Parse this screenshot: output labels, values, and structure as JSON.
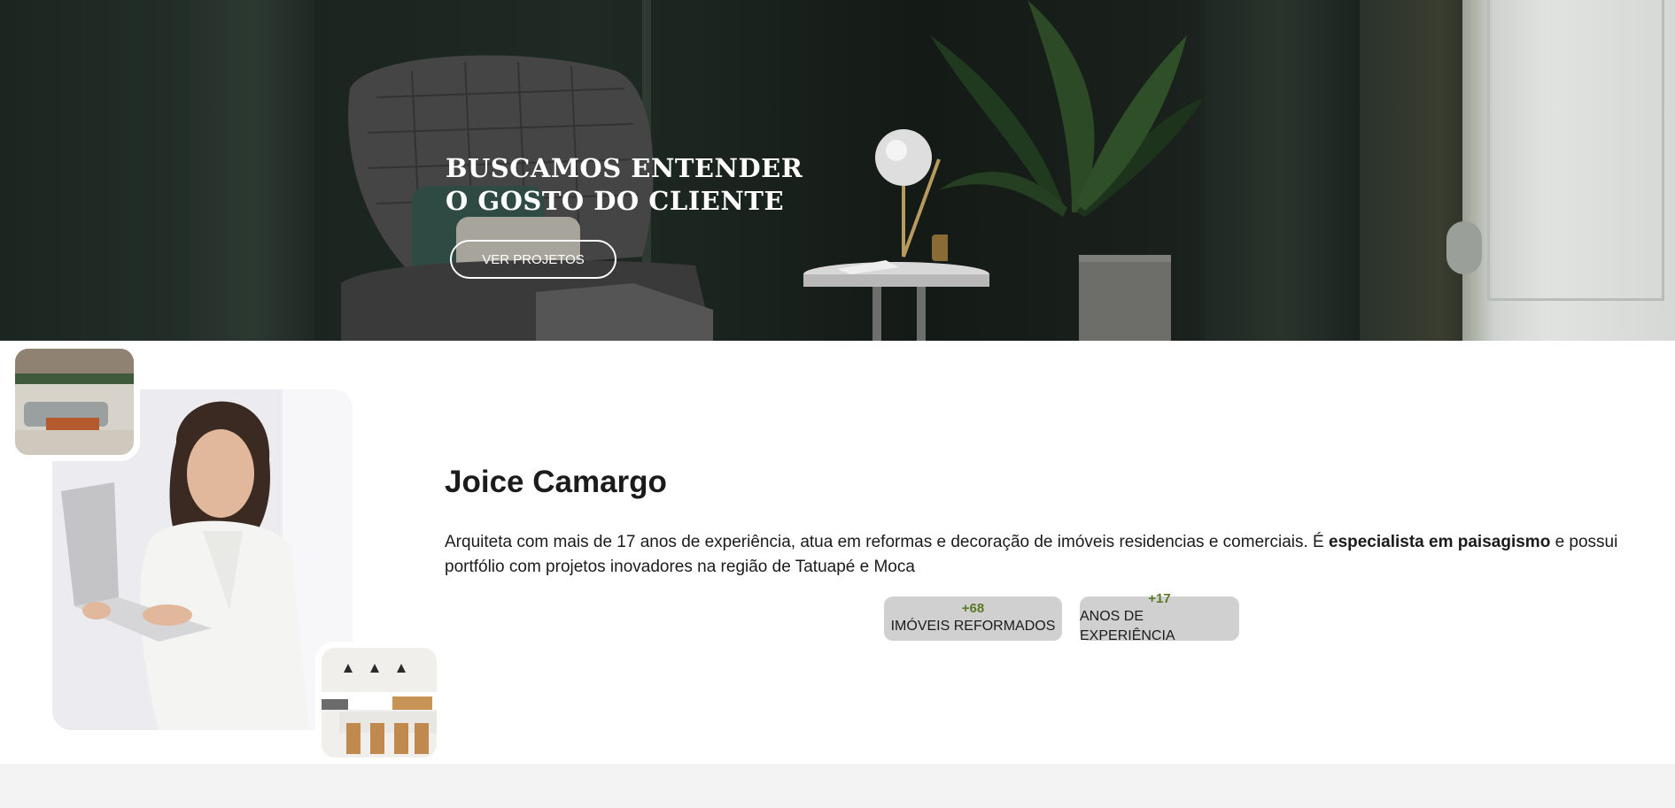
{
  "hero": {
    "title_line1": "BUSCAMOS ENTENDER",
    "title_line2": "O GOSTO DO CLIENTE",
    "cta_label": "VER PROJETOS"
  },
  "about": {
    "name": "Joice Camargo",
    "bio_prefix": "Arquiteta com mais de 17 anos de experiência, atua em reformas e decoração de imóveis residencias e comerciais. É ",
    "bio_bold": "especialista em paisagismo",
    "bio_suffix": " e possui portfólio com projetos inovadores na região de Tatuapé e Moca",
    "stats": [
      {
        "value": "+68",
        "label": "IMÓVEIS REFORMADOS"
      },
      {
        "value": "+17",
        "label": "ANOS DE EXPERIÊNCIA"
      }
    ]
  },
  "colors": {
    "accent_green": "#5a7a25",
    "stat_bg": "#d0d0d0",
    "hero_bg": "#1b241f"
  },
  "icons": [
    "hero-background-image",
    "portrait-photo",
    "living-room-thumbnail",
    "kitchen-thumbnail"
  ]
}
